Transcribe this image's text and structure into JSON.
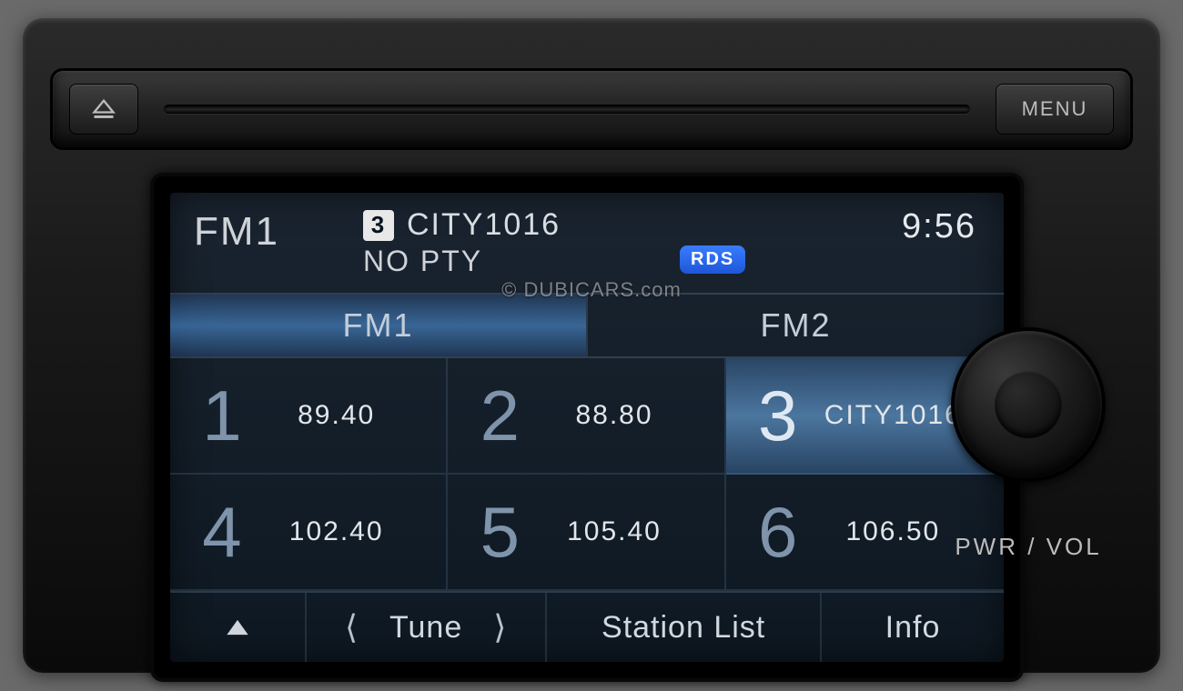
{
  "physical": {
    "menu_label": "MENU",
    "knob_label": "PWR / VOL"
  },
  "header": {
    "band": "FM1",
    "preset_number": "3",
    "station_name": "CITY1016",
    "pty_text": "NO PTY",
    "rds_badge": "RDS",
    "clock": "9:56"
  },
  "tabs": [
    {
      "label": "FM1",
      "active": true
    },
    {
      "label": "FM2",
      "active": false
    }
  ],
  "presets": [
    {
      "num": "1",
      "value": "89.40",
      "selected": false
    },
    {
      "num": "2",
      "value": "88.80",
      "selected": false
    },
    {
      "num": "3",
      "value": "CITY1016",
      "selected": true
    },
    {
      "num": "4",
      "value": "102.40",
      "selected": false
    },
    {
      "num": "5",
      "value": "105.40",
      "selected": false
    },
    {
      "num": "6",
      "value": "106.50",
      "selected": false
    }
  ],
  "footer": {
    "tune_label": "Tune",
    "station_list_label": "Station List",
    "info_label": "Info"
  },
  "watermark": "© DUBICARS.com"
}
